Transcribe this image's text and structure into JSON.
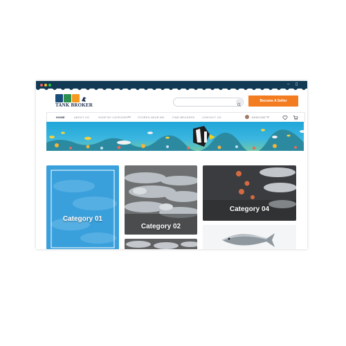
{
  "brand": {
    "name": "TANK BROKER"
  },
  "header": {
    "search_placeholder": "",
    "become_seller_label": "Become A Seller"
  },
  "nav": {
    "items": [
      "HOME",
      "ABOUT US",
      "SHOP BY CATEGORY",
      "STORES NEAR ME",
      "FIND BROKERS",
      "CONTACT US"
    ],
    "user_name": "JOHN DOE"
  },
  "categories": [
    {
      "label": "Category 01"
    },
    {
      "label": "Category 02"
    },
    {
      "label": "Category 04"
    }
  ],
  "colors": {
    "accent": "#f47c20",
    "titlebar": "#123a54",
    "category_01_overlay": "#3aa0dc"
  },
  "icons": [
    "search-icon",
    "chevron-down-icon",
    "heart-icon",
    "cart-icon",
    "avatar"
  ]
}
